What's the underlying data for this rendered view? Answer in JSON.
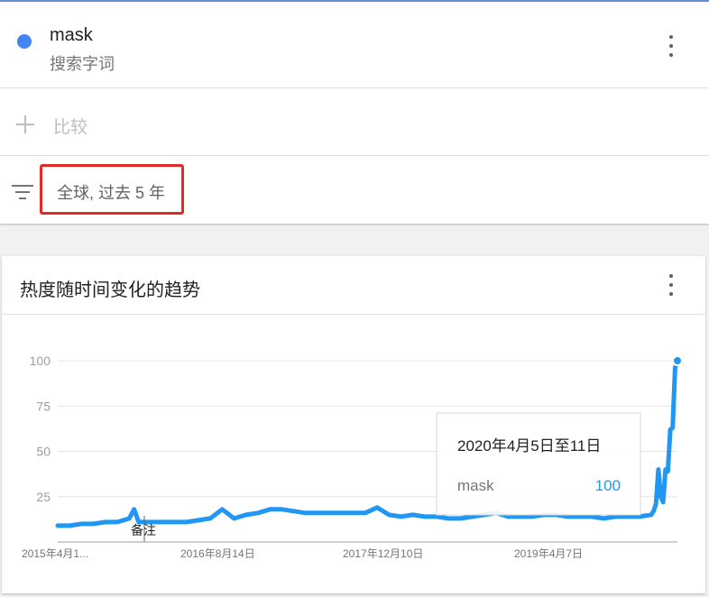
{
  "search_term": {
    "name": "mask",
    "type": "搜索字词",
    "color": "#4285f4"
  },
  "compare": {
    "label": "比较"
  },
  "filter": {
    "label": "全球, 过去 5 年",
    "highlight_color": "#e32b25"
  },
  "chart": {
    "title": "热度随时间变化的趋势",
    "annotation_label": "备注",
    "tooltip": {
      "date": "2020年4月5日至11日",
      "term": "mask",
      "value": "100"
    }
  },
  "chart_data": {
    "type": "line",
    "title": "热度随时间变化的趋势",
    "xlabel": "",
    "ylabel": "",
    "ylim": [
      0,
      100
    ],
    "yticks": [
      25,
      50,
      75,
      100
    ],
    "xtick_labels": [
      "2015年4月1...",
      "2016年8月14日",
      "2017年12月10日",
      "2019年4月7日"
    ],
    "grid": true,
    "series": [
      {
        "name": "mask",
        "color": "#2196f3",
        "x": [
          "2015-04-12",
          "2015-05-17",
          "2015-06-21",
          "2015-07-26",
          "2015-08-30",
          "2015-10-04",
          "2015-11-08",
          "2015-11-22",
          "2015-12-06",
          "2016-01-10",
          "2016-02-14",
          "2016-03-20",
          "2016-04-24",
          "2016-05-29",
          "2016-07-03",
          "2016-08-07",
          "2016-09-11",
          "2016-10-16",
          "2016-11-20",
          "2016-12-25",
          "2017-01-29",
          "2017-03-05",
          "2017-04-09",
          "2017-05-14",
          "2017-06-18",
          "2017-07-23",
          "2017-08-27",
          "2017-10-01",
          "2017-11-05",
          "2017-12-10",
          "2018-01-14",
          "2018-02-18",
          "2018-03-25",
          "2018-04-29",
          "2018-06-03",
          "2018-07-08",
          "2018-08-12",
          "2018-09-16",
          "2018-10-21",
          "2018-11-25",
          "2018-12-30",
          "2019-02-03",
          "2019-03-10",
          "2019-04-14",
          "2019-05-19",
          "2019-06-23",
          "2019-07-28",
          "2019-09-01",
          "2019-10-06",
          "2019-11-10",
          "2019-12-15",
          "2020-01-19",
          "2020-01-26",
          "2020-02-02",
          "2020-02-09",
          "2020-02-16",
          "2020-02-23",
          "2020-03-01",
          "2020-03-08",
          "2020-03-15",
          "2020-03-22",
          "2020-03-29",
          "2020-04-05"
        ],
        "values": [
          9,
          9,
          10,
          10,
          11,
          11,
          13,
          18,
          11,
          11,
          11,
          11,
          11,
          12,
          13,
          18,
          13,
          15,
          16,
          18,
          18,
          17,
          16,
          16,
          16,
          16,
          16,
          16,
          19,
          15,
          14,
          15,
          14,
          14,
          13,
          13,
          14,
          15,
          16,
          14,
          14,
          14,
          15,
          15,
          14,
          14,
          14,
          13,
          14,
          14,
          14,
          15,
          17,
          21,
          40,
          25,
          22,
          40,
          39,
          62,
          63,
          96,
          100
        ]
      }
    ]
  }
}
